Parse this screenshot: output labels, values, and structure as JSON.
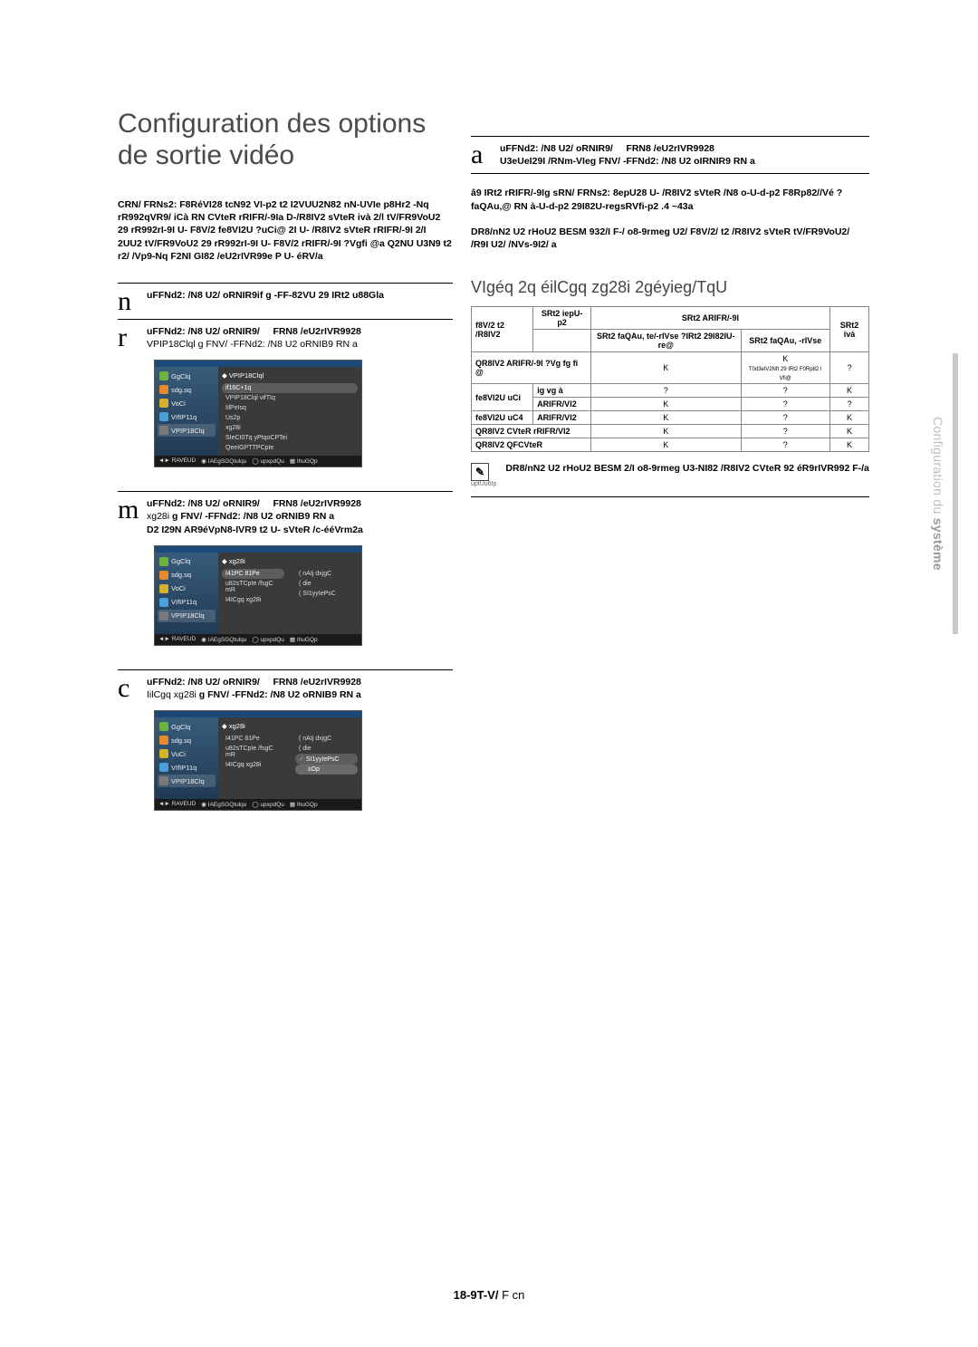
{
  "title": "Configuration des options de sortie vidéo",
  "intro": "CRN/ FRNs2: F8RéVI28 tcN92 VI-p2 t2 I2VUU2N82 nN-UVIe p8Hr2 -Nq rR992qVR9/ iCà RN CVteR rRIFR/-9Ia D-/R8IV2 sVteR ivà 2/l tV/FR9VoU2 29 rR992rI-9I U- F8V/2 fe8VI2U ?uCi@ 2I U- /R8IV2 sVteR rRIFR/-9I 2/I 2UU2 tV/FR9VoU2 29 rR992rI-9I U- F8V/2 rRIFR/-9I ?Vgfi @a Q2NU U3N9 t2 r2/ /Vp9-Nq F2NI GI82 /eU2rIVR99e P U- éRV/a",
  "steps": [
    {
      "num": "n",
      "text_a": "uFFNd2: /N8 U2/ oRNIR9if",
      "text_b": "g -FF-82VU 29 IRt2 u88Gla"
    },
    {
      "num": "r",
      "text_a": "uFFNd2: /N8 U2/ oRNIR9/",
      "text_b": "FRN8 /eU2rIVR9928",
      "text_c": "VPIP18Clql g FNV/ -FFNd2: /N8 U2 oRNIB9 RN   a"
    },
    {
      "num": "m",
      "text_a": "uFFNd2: /N8 U2/ oRNIR9/",
      "text_b": "FRN8 /eU2rIVR9928",
      "text_c": "g FNV/ -FFNd2: /N8 U2 oRNIB9 RN   a",
      "text_d": "D2 I29N AR9éVpN8-IVR9 t2 U- sVteR /c-ééVrm2a",
      "prefix": "xg28i"
    },
    {
      "num": "c",
      "text_a": "uFFNd2: /N8 U2/ oRNIR9/",
      "text_b": "FRN8 /eU2rIVR9928",
      "text_c": "g FNV/ -FFNd2: /N8 U2 oRNIB9 RN   a",
      "prefix": "IilCgq xg28i"
    },
    {
      "num": "a",
      "text_a": "uFFNd2: /N8 U2/ oRNIR9/",
      "text_b": "FRN8 /eU2rIVR9928",
      "text_c": "U3eUeI29I /RNm-VIeg FNV/ -FFNd2: /N8 U2 oIRNIR9 RN   a"
    }
  ],
  "shot": {
    "side": [
      "GgClq",
      "sdg.sq",
      "VoCi",
      "VIfIP11q",
      "VPIP18Clq"
    ],
    "side2": [
      "GgClq",
      "sdg.sq",
      "VuCi",
      "VIfIP11q",
      "VPIP18Clq"
    ],
    "footers": [
      "RAVEUD",
      "IAEgSGQtulqu",
      "upxpdQu",
      "IhuGQp"
    ],
    "s1_title": "VPIP18Clql",
    "s1_opts": [
      "if16C+1q",
      "VPIP18Clql vifTIq",
      "IilPeIsq",
      "Us2p",
      "xg28i",
      "SIeCI0Tq yPtqoCPTei",
      "QeeIGPTTPCpIe"
    ],
    "s2_title": "xg28i",
    "s2_left": [
      "I41PC 81Pe",
      "u82sTCpIe /fsgC mR",
      "I4ICgq xg28i"
    ],
    "s2_right": [
      "( nAIj dxjgC",
      "( die",
      "( SI1yyIePsC"
    ],
    "s3_title": "xg28i",
    "s3_left": [
      "I41PC 81Pe",
      "u82sTCpIe /fsgC mR",
      "I4ICgq xg28i",
      ""
    ],
    "s3_right": [
      "( nAIj dxjgC",
      "( die",
      "SI1yyIePsC",
      "sOp"
    ]
  },
  "rightNote": "â9 IRt2 rRIFR/-9Ig sRN/ FRNs2: 8epU28 U- /R8IV2 sVteR /N8 o-U-d-p2 F8Rp82//Vé ?faQAu,@ RN à-U-d-p2 29I82U-regsRVfi-p2 .4 ~43a",
  "rightNote2": "DR8/nN2 U2 rHoU2 BESM 932/I F-/ o8-9rmeg U2/ F8V/2/ t2 /R8IV2 sVteR tV/FR9VoU2/ /R9I U2/ /NVs-9I2/ a",
  "tableTitle": "VIgéq 2q éilCgq zg28i 2géyieg/TqU",
  "chart_data": {
    "type": "table",
    "headers_row1": [
      "",
      "SRt2 iepU-p2",
      "SRt2 ARIFR/-9I",
      "",
      "SRt2 ivà"
    ],
    "headers_row2": [
      "f8V/2 t2 /R8IV2",
      "",
      "SRt2 faQAu, te/-rIVse ?IRt2 29I82IU-re@",
      "SRt2 faQAu, -rIVse",
      ""
    ],
    "rows": [
      {
        "h1": "QR8IV2 ARIFR/-9I ?Vg fg fi @",
        "c": [
          "K",
          "K",
          "?"
        ],
        "note": "T0d3elV2Nft 29 IRt2 F0Rp82 I Vfi@"
      },
      {
        "h1": "fe8VI2U uCi ig vg à",
        "c": [
          "?",
          "?",
          "K"
        ]
      },
      {
        "h1": "fe8VI2U uCi ARIFR/VI2",
        "c": [
          "K",
          "?",
          "?"
        ]
      },
      {
        "h1": "fe8VI2U uC4 ARIFR/VI2",
        "c": [
          "K",
          "?",
          "K"
        ]
      },
      {
        "h1": "QR8IV2 CVteR rRIFR/VI2",
        "c": [
          "K",
          "?",
          "K"
        ]
      },
      {
        "h1": "QR8IV2 QFCVteR",
        "c": [
          "K",
          "?",
          "K"
        ]
      }
    ]
  },
  "bottomNote": "DR8/nN2 U2 rHoU2 BESM 2/I o8-9rmeg U3-NI82 /R8IV2 CVteR 92 éR9rIVR992 F-/a",
  "bottomNoteSub": "uptUu6Ip",
  "sideLabel1": "Configuration du",
  "sideLabel2": "système",
  "pageNum": "18-9T-V/",
  "pageSuffix": "F cn"
}
